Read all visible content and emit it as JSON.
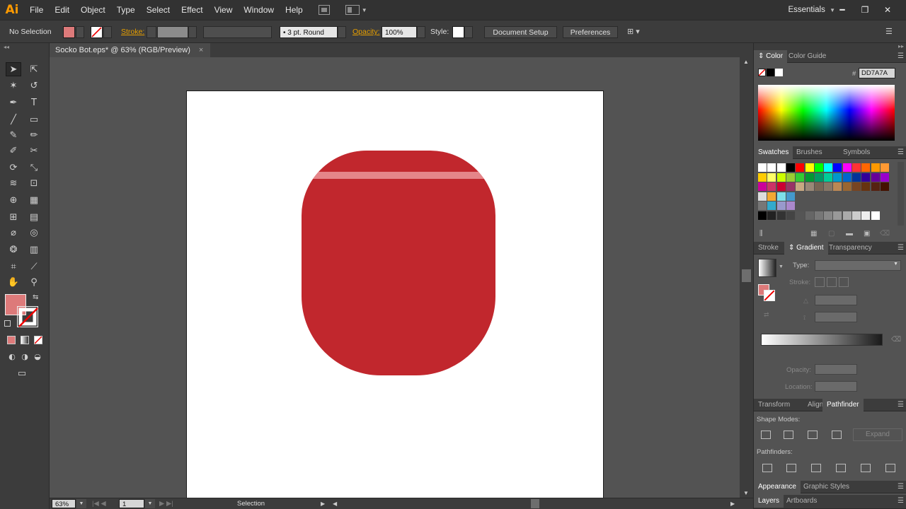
{
  "app": {
    "logo": "Ai"
  },
  "menu": {
    "items": [
      "File",
      "Edit",
      "Object",
      "Type",
      "Select",
      "Effect",
      "View",
      "Window",
      "Help"
    ],
    "workspace": "Essentials"
  },
  "control_bar": {
    "selection_state": "No Selection",
    "fill_color": "#DD7A7A",
    "stroke_label": "Stroke:",
    "profile_label": "3 pt. Round",
    "opacity_label": "Opacity:",
    "opacity_value": "100%",
    "style_label": "Style:",
    "document_setup": "Document Setup",
    "preferences": "Preferences"
  },
  "document": {
    "tab_title": "Socko Bot.eps* @ 63% (RGB/Preview)",
    "close": "×"
  },
  "canvas": {
    "shape_color": "#C1272D",
    "highlight_color": "#E78A8E"
  },
  "status": {
    "zoom": "63%",
    "artboard_number": "1",
    "tool_name": "Selection"
  },
  "panels": {
    "color": {
      "tabs": [
        "Color",
        "Color Guide"
      ],
      "hex_symbol": "#",
      "hex": "DD7A7A"
    },
    "swatches": {
      "tabs": [
        "Swatches",
        "Brushes",
        "Symbols"
      ]
    },
    "gradient": {
      "tabs": [
        "Stroke",
        "Gradient",
        "Transparency"
      ],
      "type_label": "Type:",
      "stroke_label": "Stroke:",
      "opacity_label": "Opacity:",
      "location_label": "Location:"
    },
    "pathfinder": {
      "tabs": [
        "Transform",
        "Align",
        "Pathfinder"
      ],
      "shape_modes": "Shape Modes:",
      "pathfinders": "Pathfinders:",
      "expand": "Expand"
    },
    "appearance": {
      "tabs": [
        "Appearance",
        "Graphic Styles"
      ]
    },
    "layers": {
      "tabs": [
        "Layers",
        "Artboards"
      ]
    }
  },
  "tools": [
    "selection-tool",
    "direct-selection-tool",
    "magic-wand-tool",
    "lasso-tool",
    "pen-tool",
    "type-tool",
    "line-tool",
    "rectangle-tool",
    "paintbrush-tool",
    "pencil-tool",
    "blob-brush-tool",
    "scissors-tool",
    "rotate-tool",
    "scale-tool",
    "width-tool",
    "free-transform-tool",
    "shape-builder-tool",
    "perspective-grid-tool",
    "mesh-tool",
    "gradient-tool",
    "eyedropper-tool",
    "blend-tool",
    "symbol-sprayer-tool",
    "column-graph-tool",
    "artboard-tool",
    "slice-tool",
    "hand-tool",
    "zoom-tool"
  ]
}
